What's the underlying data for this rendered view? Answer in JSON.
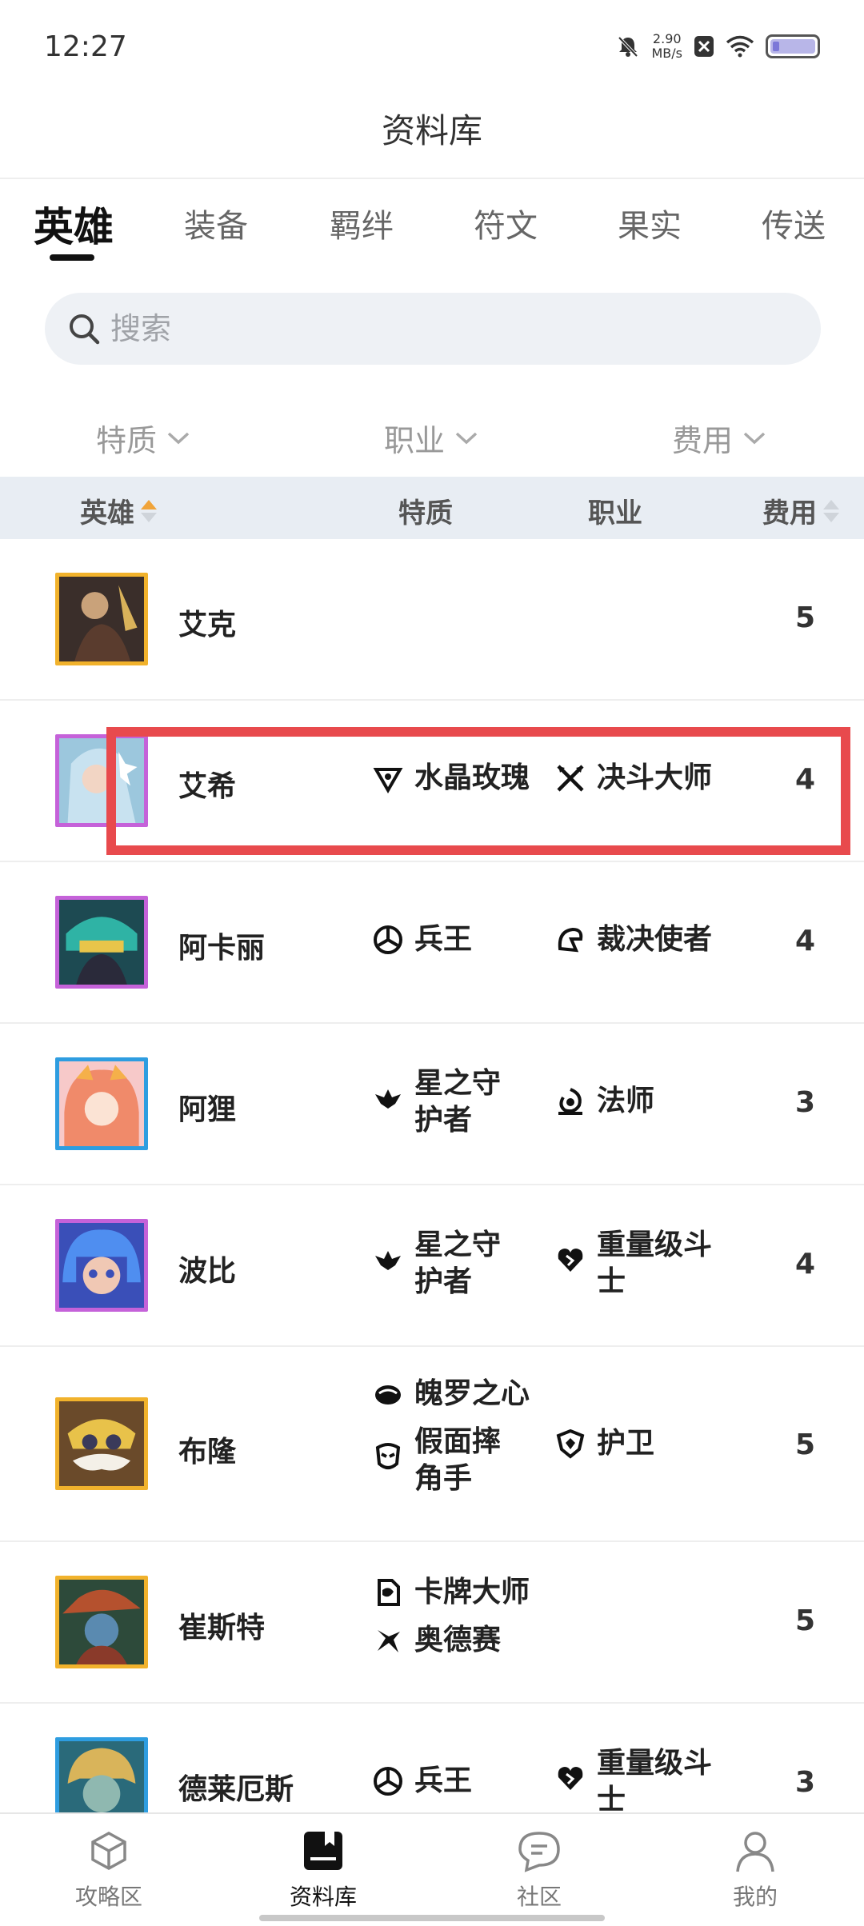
{
  "status_bar": {
    "time": "12:27",
    "net_speed_value": "2.90",
    "net_speed_unit": "MB/s"
  },
  "page": {
    "title": "资料库"
  },
  "tabs": [
    {
      "label": "英雄",
      "active": true
    },
    {
      "label": "装备"
    },
    {
      "label": "羁绊"
    },
    {
      "label": "符文"
    },
    {
      "label": "果实"
    },
    {
      "label": "传送"
    }
  ],
  "search": {
    "placeholder": "搜索"
  },
  "filters": [
    {
      "label": "特质"
    },
    {
      "label": "职业"
    },
    {
      "label": "费用"
    }
  ],
  "table_header": {
    "hero": "英雄",
    "trait": "特质",
    "class": "职业",
    "cost": "费用"
  },
  "heroes": [
    {
      "name": "艾克",
      "traits": [],
      "classes": [],
      "cost": "5"
    },
    {
      "name": "艾希",
      "traits": [
        "水晶玫瑰"
      ],
      "classes": [
        "决斗大师"
      ],
      "cost": "4"
    },
    {
      "name": "阿卡丽",
      "traits": [
        "兵王"
      ],
      "classes": [
        "裁决使者"
      ],
      "cost": "4"
    },
    {
      "name": "阿狸",
      "traits": [
        "星之守护者"
      ],
      "classes": [
        "法师"
      ],
      "cost": "3"
    },
    {
      "name": "波比",
      "traits": [
        "星之守护者"
      ],
      "classes": [
        "重量级斗士"
      ],
      "cost": "4"
    },
    {
      "name": "布隆",
      "traits": [
        "魄罗之心",
        "假面摔角手"
      ],
      "classes": [
        "护卫"
      ],
      "cost": "5"
    },
    {
      "name": "崔斯特",
      "traits": [
        "卡牌大师",
        "奥德赛"
      ],
      "classes": [],
      "cost": "5"
    },
    {
      "name": "德莱厄斯",
      "traits": [
        "兵王"
      ],
      "classes": [
        "重量级斗士"
      ],
      "cost": "3"
    }
  ],
  "bottom_nav": [
    {
      "label": "攻略区",
      "icon": "cube-icon"
    },
    {
      "label": "资料库",
      "icon": "book-icon",
      "active": true
    },
    {
      "label": "社区",
      "icon": "chat-icon"
    },
    {
      "label": "我的",
      "icon": "person-icon"
    }
  ],
  "colors": {
    "accent": "#111111",
    "highlight": "#e84a4d",
    "sort_active": "#f0a43a",
    "cost5": "#f1b22c",
    "cost4": "#c562d9",
    "cost3": "#2e9de0"
  }
}
